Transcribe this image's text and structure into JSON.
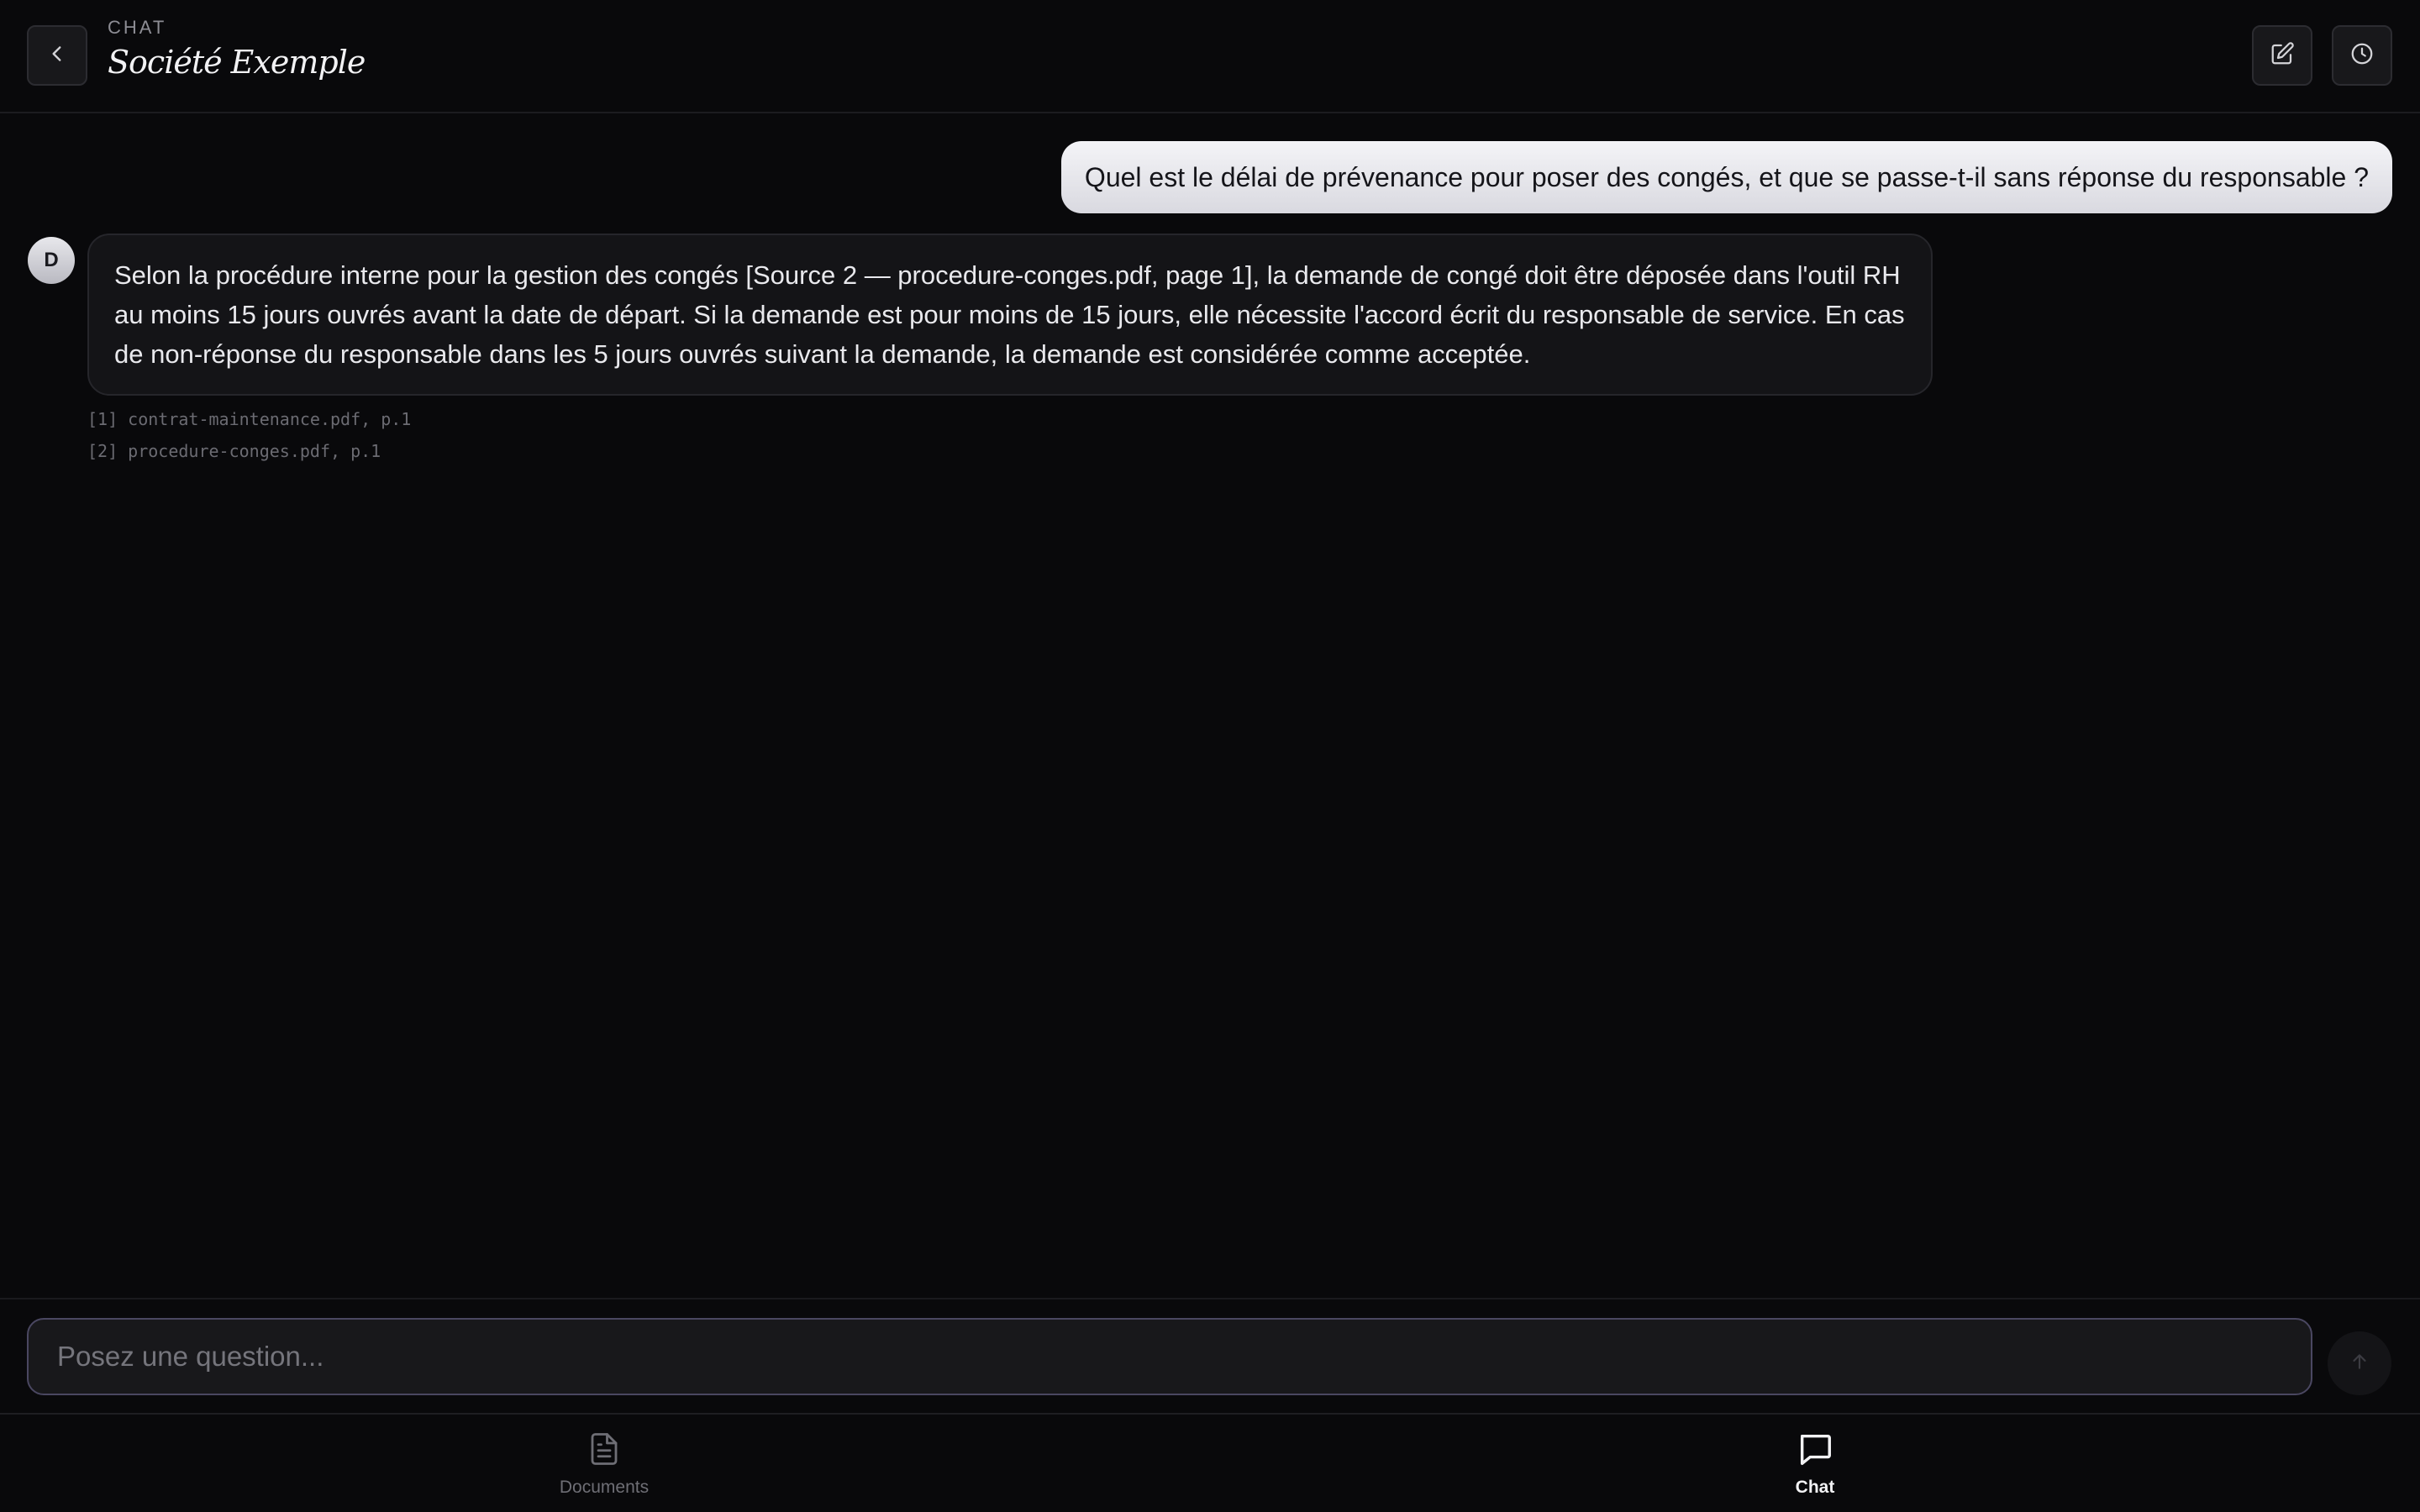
{
  "header": {
    "eyebrow": "CHAT",
    "title": "Société Exemple"
  },
  "messages": {
    "user": "Quel est le délai de prévenance pour poser des congés, et que se passe-t-il sans réponse du responsable ?",
    "assistant_avatar": "D",
    "assistant": "Selon la procédure interne pour la gestion des congés [Source 2 — procedure-conges.pdf, page 1], la demande de congé doit être déposée dans l'outil RH au moins 15 jours ouvrés avant la date de départ. Si la demande est pour moins de 15 jours, elle nécessite l'accord écrit du responsable de service. En cas de non-réponse du responsable dans les 5 jours ouvrés suivant la demande, la demande est considérée comme acceptée.",
    "sources": [
      "[1] contrat-maintenance.pdf, p.1",
      "[2] procedure-conges.pdf, p.1"
    ]
  },
  "composer": {
    "placeholder": "Posez une question...",
    "value": ""
  },
  "nav": {
    "documents_label": "Documents",
    "chat_label": "Chat",
    "active": "chat"
  },
  "icons": {
    "back": "chevron-left-icon",
    "edit": "edit-icon",
    "history": "clock-icon",
    "send": "arrow-up-icon",
    "documents": "document-icon",
    "chat": "chat-bubble-icon"
  },
  "colors": {
    "background": "#09090b",
    "input_border": "#4a4761",
    "user_bubble": "#ececf0"
  }
}
